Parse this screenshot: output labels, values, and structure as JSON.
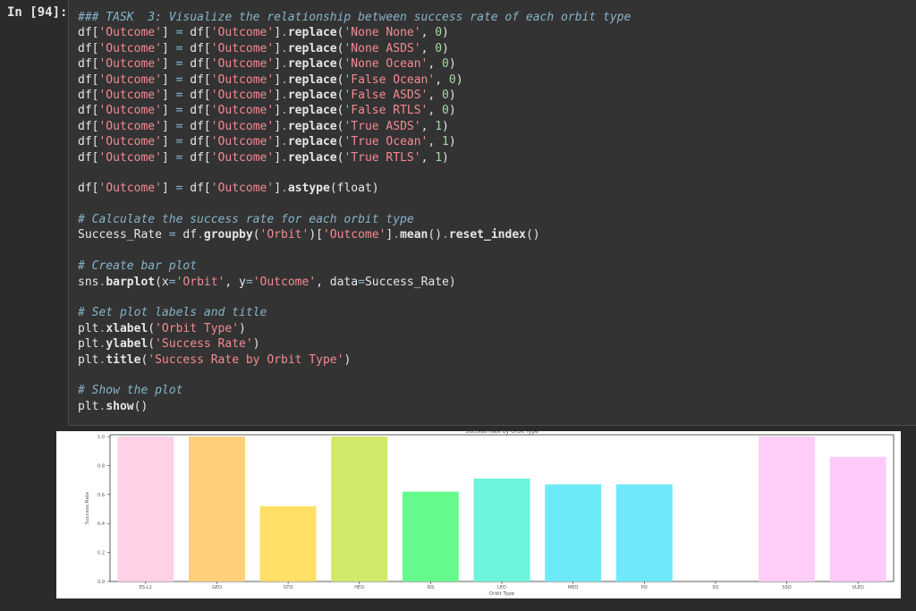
{
  "prompt": "In [94]:",
  "code_lines": [
    [
      [
        "c",
        "### TASK  3: Visualize the relationship between success rate of each orbit type"
      ]
    ],
    [
      [
        "t",
        "df["
      ],
      [
        "s",
        "'Outcome'"
      ],
      [
        "t",
        "] "
      ],
      [
        "o",
        "="
      ],
      [
        "t",
        " df["
      ],
      [
        "s",
        "'Outcome'"
      ],
      [
        "t",
        "]"
      ],
      [
        "o",
        "."
      ],
      [
        "f",
        "replace"
      ],
      [
        "t",
        "("
      ],
      [
        "s",
        "'None None'"
      ],
      [
        "t",
        ", "
      ],
      [
        "n",
        "0"
      ],
      [
        "t",
        ")"
      ]
    ],
    [
      [
        "t",
        "df["
      ],
      [
        "s",
        "'Outcome'"
      ],
      [
        "t",
        "] "
      ],
      [
        "o",
        "="
      ],
      [
        "t",
        " df["
      ],
      [
        "s",
        "'Outcome'"
      ],
      [
        "t",
        "]"
      ],
      [
        "o",
        "."
      ],
      [
        "f",
        "replace"
      ],
      [
        "t",
        "("
      ],
      [
        "s",
        "'None ASDS'"
      ],
      [
        "t",
        ", "
      ],
      [
        "n",
        "0"
      ],
      [
        "t",
        ")"
      ]
    ],
    [
      [
        "t",
        "df["
      ],
      [
        "s",
        "'Outcome'"
      ],
      [
        "t",
        "] "
      ],
      [
        "o",
        "="
      ],
      [
        "t",
        " df["
      ],
      [
        "s",
        "'Outcome'"
      ],
      [
        "t",
        "]"
      ],
      [
        "o",
        "."
      ],
      [
        "f",
        "replace"
      ],
      [
        "t",
        "("
      ],
      [
        "s",
        "'None Ocean'"
      ],
      [
        "t",
        ", "
      ],
      [
        "n",
        "0"
      ],
      [
        "t",
        ")"
      ]
    ],
    [
      [
        "t",
        "df["
      ],
      [
        "s",
        "'Outcome'"
      ],
      [
        "t",
        "] "
      ],
      [
        "o",
        "="
      ],
      [
        "t",
        " df["
      ],
      [
        "s",
        "'Outcome'"
      ],
      [
        "t",
        "]"
      ],
      [
        "o",
        "."
      ],
      [
        "f",
        "replace"
      ],
      [
        "t",
        "("
      ],
      [
        "s",
        "'False Ocean'"
      ],
      [
        "t",
        ", "
      ],
      [
        "n",
        "0"
      ],
      [
        "t",
        ")"
      ]
    ],
    [
      [
        "t",
        "df["
      ],
      [
        "s",
        "'Outcome'"
      ],
      [
        "t",
        "] "
      ],
      [
        "o",
        "="
      ],
      [
        "t",
        " df["
      ],
      [
        "s",
        "'Outcome'"
      ],
      [
        "t",
        "]"
      ],
      [
        "o",
        "."
      ],
      [
        "f",
        "replace"
      ],
      [
        "t",
        "("
      ],
      [
        "s",
        "'False ASDS'"
      ],
      [
        "t",
        ", "
      ],
      [
        "n",
        "0"
      ],
      [
        "t",
        ")"
      ]
    ],
    [
      [
        "t",
        "df["
      ],
      [
        "s",
        "'Outcome'"
      ],
      [
        "t",
        "] "
      ],
      [
        "o",
        "="
      ],
      [
        "t",
        " df["
      ],
      [
        "s",
        "'Outcome'"
      ],
      [
        "t",
        "]"
      ],
      [
        "o",
        "."
      ],
      [
        "f",
        "replace"
      ],
      [
        "t",
        "("
      ],
      [
        "s",
        "'False RTLS'"
      ],
      [
        "t",
        ", "
      ],
      [
        "n",
        "0"
      ],
      [
        "t",
        ")"
      ]
    ],
    [
      [
        "t",
        "df["
      ],
      [
        "s",
        "'Outcome'"
      ],
      [
        "t",
        "] "
      ],
      [
        "o",
        "="
      ],
      [
        "t",
        " df["
      ],
      [
        "s",
        "'Outcome'"
      ],
      [
        "t",
        "]"
      ],
      [
        "o",
        "."
      ],
      [
        "f",
        "replace"
      ],
      [
        "t",
        "("
      ],
      [
        "s",
        "'True ASDS'"
      ],
      [
        "t",
        ", "
      ],
      [
        "n",
        "1"
      ],
      [
        "t",
        ")"
      ]
    ],
    [
      [
        "t",
        "df["
      ],
      [
        "s",
        "'Outcome'"
      ],
      [
        "t",
        "] "
      ],
      [
        "o",
        "="
      ],
      [
        "t",
        " df["
      ],
      [
        "s",
        "'Outcome'"
      ],
      [
        "t",
        "]"
      ],
      [
        "o",
        "."
      ],
      [
        "f",
        "replace"
      ],
      [
        "t",
        "("
      ],
      [
        "s",
        "'True Ocean'"
      ],
      [
        "t",
        ", "
      ],
      [
        "n",
        "1"
      ],
      [
        "t",
        ")"
      ]
    ],
    [
      [
        "t",
        "df["
      ],
      [
        "s",
        "'Outcome'"
      ],
      [
        "t",
        "] "
      ],
      [
        "o",
        "="
      ],
      [
        "t",
        " df["
      ],
      [
        "s",
        "'Outcome'"
      ],
      [
        "t",
        "]"
      ],
      [
        "o",
        "."
      ],
      [
        "f",
        "replace"
      ],
      [
        "t",
        "("
      ],
      [
        "s",
        "'True RTLS'"
      ],
      [
        "t",
        ", "
      ],
      [
        "n",
        "1"
      ],
      [
        "t",
        ")"
      ]
    ],
    [],
    [
      [
        "t",
        "df["
      ],
      [
        "s",
        "'Outcome'"
      ],
      [
        "t",
        "] "
      ],
      [
        "o",
        "="
      ],
      [
        "t",
        " df["
      ],
      [
        "s",
        "'Outcome'"
      ],
      [
        "t",
        "]"
      ],
      [
        "o",
        "."
      ],
      [
        "f",
        "astype"
      ],
      [
        "t",
        "(float)"
      ]
    ],
    [],
    [
      [
        "c",
        "# Calculate the success rate for each orbit type"
      ]
    ],
    [
      [
        "t",
        "Success_Rate "
      ],
      [
        "o",
        "="
      ],
      [
        "t",
        " df"
      ],
      [
        "o",
        "."
      ],
      [
        "f",
        "groupby"
      ],
      [
        "t",
        "("
      ],
      [
        "s",
        "'Orbit'"
      ],
      [
        "t",
        ")["
      ],
      [
        "s",
        "'Outcome'"
      ],
      [
        "t",
        "]"
      ],
      [
        "o",
        "."
      ],
      [
        "f",
        "mean"
      ],
      [
        "t",
        "()"
      ],
      [
        "o",
        "."
      ],
      [
        "f",
        "reset_index"
      ],
      [
        "t",
        "()"
      ]
    ],
    [],
    [
      [
        "c",
        "# Create bar plot"
      ]
    ],
    [
      [
        "t",
        "sns"
      ],
      [
        "o",
        "."
      ],
      [
        "f",
        "barplot"
      ],
      [
        "t",
        "(x"
      ],
      [
        "o",
        "="
      ],
      [
        "s",
        "'Orbit'"
      ],
      [
        "t",
        ", y"
      ],
      [
        "o",
        "="
      ],
      [
        "s",
        "'Outcome'"
      ],
      [
        "t",
        ", data"
      ],
      [
        "o",
        "="
      ],
      [
        "t",
        "Success_Rate)"
      ]
    ],
    [],
    [
      [
        "c",
        "# Set plot labels and title"
      ]
    ],
    [
      [
        "t",
        "plt"
      ],
      [
        "o",
        "."
      ],
      [
        "f",
        "xlabel"
      ],
      [
        "t",
        "("
      ],
      [
        "s",
        "'Orbit Type'"
      ],
      [
        "t",
        ")"
      ]
    ],
    [
      [
        "t",
        "plt"
      ],
      [
        "o",
        "."
      ],
      [
        "f",
        "ylabel"
      ],
      [
        "t",
        "("
      ],
      [
        "s",
        "'Success Rate'"
      ],
      [
        "t",
        ")"
      ]
    ],
    [
      [
        "t",
        "plt"
      ],
      [
        "o",
        "."
      ],
      [
        "f",
        "title"
      ],
      [
        "t",
        "("
      ],
      [
        "s",
        "'Success Rate by Orbit Type'"
      ],
      [
        "t",
        ")"
      ]
    ],
    [],
    [
      [
        "c",
        "# Show the plot"
      ]
    ],
    [
      [
        "t",
        "plt"
      ],
      [
        "o",
        "."
      ],
      [
        "f",
        "show"
      ],
      [
        "t",
        "()"
      ]
    ]
  ],
  "chart_data": {
    "type": "bar",
    "title": "Success Rate by Orbit Type",
    "xlabel": "Orbit Type",
    "ylabel": "Success Rate",
    "categories": [
      "ES-L1",
      "GEO",
      "GTO",
      "HEO",
      "ISS",
      "LEO",
      "MEO",
      "PO",
      "SO",
      "SSO",
      "VLEO"
    ],
    "values": [
      1.0,
      1.0,
      0.52,
      1.0,
      0.62,
      0.71,
      0.67,
      0.67,
      0.0,
      1.0,
      0.86
    ],
    "colors": [
      "#ffd1e6",
      "#ffd079",
      "#ffdf66",
      "#cfea6a",
      "#66fa8e",
      "#6cf5dc",
      "#6eeaf6",
      "#6ee8fa",
      "#ffffff",
      "#ffcdf8",
      "#ffc9fa"
    ],
    "ylim": [
      0,
      1.0
    ],
    "yticks": [
      0.0,
      0.2,
      0.4,
      0.6,
      0.8,
      1.0
    ],
    "ytick_labels": [
      "0.0",
      "0.2",
      "0.4",
      "0.6",
      "0.8",
      "1.0"
    ],
    "grid": false
  }
}
